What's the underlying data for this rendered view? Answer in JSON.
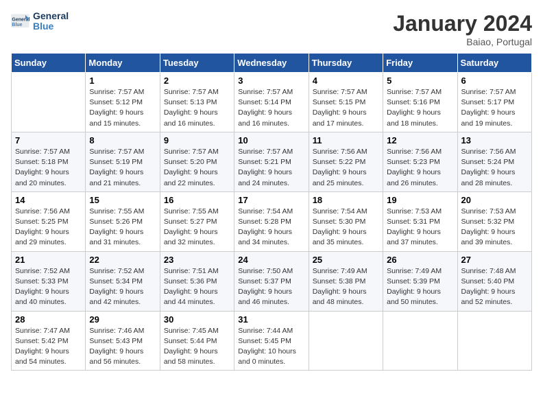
{
  "header": {
    "logo_general": "General",
    "logo_blue": "Blue",
    "month": "January 2024",
    "location": "Baiao, Portugal"
  },
  "columns": [
    "Sunday",
    "Monday",
    "Tuesday",
    "Wednesday",
    "Thursday",
    "Friday",
    "Saturday"
  ],
  "weeks": [
    [
      {
        "day": "",
        "empty": true
      },
      {
        "day": "1",
        "sunrise": "7:57 AM",
        "sunset": "5:12 PM",
        "daylight": "9 hours and 15 minutes."
      },
      {
        "day": "2",
        "sunrise": "7:57 AM",
        "sunset": "5:13 PM",
        "daylight": "9 hours and 16 minutes."
      },
      {
        "day": "3",
        "sunrise": "7:57 AM",
        "sunset": "5:14 PM",
        "daylight": "9 hours and 16 minutes."
      },
      {
        "day": "4",
        "sunrise": "7:57 AM",
        "sunset": "5:15 PM",
        "daylight": "9 hours and 17 minutes."
      },
      {
        "day": "5",
        "sunrise": "7:57 AM",
        "sunset": "5:16 PM",
        "daylight": "9 hours and 18 minutes."
      },
      {
        "day": "6",
        "sunrise": "7:57 AM",
        "sunset": "5:17 PM",
        "daylight": "9 hours and 19 minutes."
      }
    ],
    [
      {
        "day": "7",
        "sunrise": "7:57 AM",
        "sunset": "5:18 PM",
        "daylight": "9 hours and 20 minutes."
      },
      {
        "day": "8",
        "sunrise": "7:57 AM",
        "sunset": "5:19 PM",
        "daylight": "9 hours and 21 minutes."
      },
      {
        "day": "9",
        "sunrise": "7:57 AM",
        "sunset": "5:20 PM",
        "daylight": "9 hours and 22 minutes."
      },
      {
        "day": "10",
        "sunrise": "7:57 AM",
        "sunset": "5:21 PM",
        "daylight": "9 hours and 24 minutes."
      },
      {
        "day": "11",
        "sunrise": "7:56 AM",
        "sunset": "5:22 PM",
        "daylight": "9 hours and 25 minutes."
      },
      {
        "day": "12",
        "sunrise": "7:56 AM",
        "sunset": "5:23 PM",
        "daylight": "9 hours and 26 minutes."
      },
      {
        "day": "13",
        "sunrise": "7:56 AM",
        "sunset": "5:24 PM",
        "daylight": "9 hours and 28 minutes."
      }
    ],
    [
      {
        "day": "14",
        "sunrise": "7:56 AM",
        "sunset": "5:25 PM",
        "daylight": "9 hours and 29 minutes."
      },
      {
        "day": "15",
        "sunrise": "7:55 AM",
        "sunset": "5:26 PM",
        "daylight": "9 hours and 31 minutes."
      },
      {
        "day": "16",
        "sunrise": "7:55 AM",
        "sunset": "5:27 PM",
        "daylight": "9 hours and 32 minutes."
      },
      {
        "day": "17",
        "sunrise": "7:54 AM",
        "sunset": "5:28 PM",
        "daylight": "9 hours and 34 minutes."
      },
      {
        "day": "18",
        "sunrise": "7:54 AM",
        "sunset": "5:30 PM",
        "daylight": "9 hours and 35 minutes."
      },
      {
        "day": "19",
        "sunrise": "7:53 AM",
        "sunset": "5:31 PM",
        "daylight": "9 hours and 37 minutes."
      },
      {
        "day": "20",
        "sunrise": "7:53 AM",
        "sunset": "5:32 PM",
        "daylight": "9 hours and 39 minutes."
      }
    ],
    [
      {
        "day": "21",
        "sunrise": "7:52 AM",
        "sunset": "5:33 PM",
        "daylight": "9 hours and 40 minutes."
      },
      {
        "day": "22",
        "sunrise": "7:52 AM",
        "sunset": "5:34 PM",
        "daylight": "9 hours and 42 minutes."
      },
      {
        "day": "23",
        "sunrise": "7:51 AM",
        "sunset": "5:36 PM",
        "daylight": "9 hours and 44 minutes."
      },
      {
        "day": "24",
        "sunrise": "7:50 AM",
        "sunset": "5:37 PM",
        "daylight": "9 hours and 46 minutes."
      },
      {
        "day": "25",
        "sunrise": "7:49 AM",
        "sunset": "5:38 PM",
        "daylight": "9 hours and 48 minutes."
      },
      {
        "day": "26",
        "sunrise": "7:49 AM",
        "sunset": "5:39 PM",
        "daylight": "9 hours and 50 minutes."
      },
      {
        "day": "27",
        "sunrise": "7:48 AM",
        "sunset": "5:40 PM",
        "daylight": "9 hours and 52 minutes."
      }
    ],
    [
      {
        "day": "28",
        "sunrise": "7:47 AM",
        "sunset": "5:42 PM",
        "daylight": "9 hours and 54 minutes."
      },
      {
        "day": "29",
        "sunrise": "7:46 AM",
        "sunset": "5:43 PM",
        "daylight": "9 hours and 56 minutes."
      },
      {
        "day": "30",
        "sunrise": "7:45 AM",
        "sunset": "5:44 PM",
        "daylight": "9 hours and 58 minutes."
      },
      {
        "day": "31",
        "sunrise": "7:44 AM",
        "sunset": "5:45 PM",
        "daylight": "10 hours and 0 minutes."
      },
      {
        "day": "",
        "empty": true
      },
      {
        "day": "",
        "empty": true
      },
      {
        "day": "",
        "empty": true
      }
    ]
  ],
  "labels": {
    "sunrise_prefix": "Sunrise: ",
    "sunset_prefix": "Sunset: ",
    "daylight_prefix": "Daylight: "
  }
}
